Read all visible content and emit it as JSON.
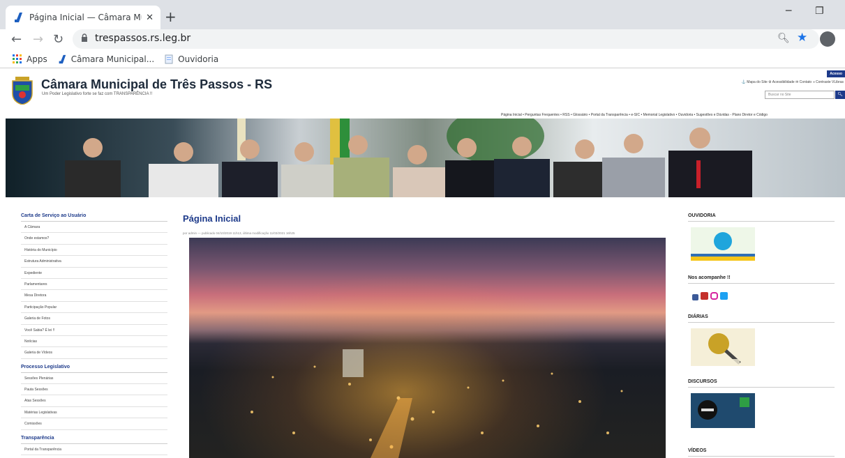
{
  "browser": {
    "tab_title": "Página Inicial — Câmara Municip",
    "tab_close": "✕",
    "new_tab": "+",
    "url": "trespassos.rs.leg.br",
    "bookmarks": [
      {
        "label": "Apps"
      },
      {
        "label": "Câmara Municipal..."
      },
      {
        "label": "Ouvidoria"
      }
    ]
  },
  "site": {
    "title": "Câmara Municipal de Três Passos - RS",
    "tagline": "Um Poder Legislativo forte se faz com TRANSPARÊNCIA !!",
    "acesso": "Acesso",
    "util_links": "⚓ Mapa do Site  ⚙ Acessibilidade  ✉ Contato  ◑ Contraste  VLibras",
    "search_placeholder": "Buscar no Site",
    "topnav": "Página Inicial  •  Perguntas Frequentes  •  RSS  •  Glossário  •  Portal da Transparência  •  e-SIC  •  Memorial Legislativo  •  Ouvidoria  •  Sugestões e Dúvidas - Plano Diretor e Código"
  },
  "left_sidebar": {
    "sections": [
      {
        "title": "Carta de Serviço ao Usuário",
        "items": [
          "A Câmara",
          "Onde estamos?",
          "História do Município",
          "Estrutura Administrativa",
          "Expediente",
          "Parlamentares",
          "Mesa Diretora",
          "Participação Popular",
          "Galeria de Fotos",
          "Você Sabia? É lei !!",
          "Notícias",
          "Galeria de Vídeos"
        ]
      },
      {
        "title": "Processo Legislativo",
        "items": [
          "Sessões Plenárias",
          "Pauta Sessões",
          "Atas Sessões",
          "Matérias Legislativas",
          "Comissões"
        ]
      },
      {
        "title": "Transparência",
        "items": [
          "Portal da Transparência"
        ]
      }
    ]
  },
  "main": {
    "title": "Página Inicial",
    "byline": "por admin — publicado 04/10/2019 11h13, última modificação 11/03/2021 16h25"
  },
  "right_sidebar": {
    "ouvidoria": "OUVIDORIA",
    "follow": "Nos acompanhe !!",
    "diarias": "DIÁRIAS",
    "discursos": "DISCURSOS",
    "videos": "VÍDEOS"
  }
}
